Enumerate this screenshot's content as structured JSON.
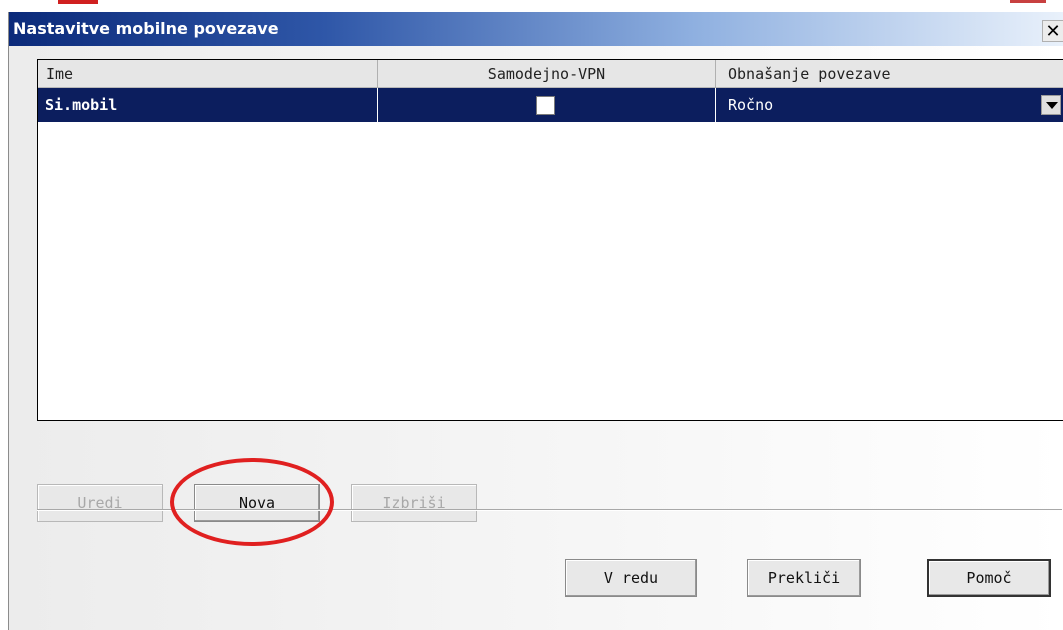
{
  "window": {
    "title": "Nastavitve mobilne povezave",
    "close_symbol": "✕"
  },
  "table": {
    "columns": [
      "Ime",
      "Samodejno-VPN",
      "Obnašanje povezave"
    ],
    "rows": [
      {
        "name": "Si.mobil",
        "auto_vpn": false,
        "behavior": "Ročno"
      }
    ]
  },
  "actions": {
    "edit": "Uredi",
    "new": "Nova",
    "delete": "Izbriši"
  },
  "footer": {
    "ok": "V redu",
    "cancel": "Prekliči",
    "help": "Pomoč"
  },
  "colors": {
    "selection": "#0c1e5e",
    "title_start": "#0b2a7a",
    "highlight": "#e02020"
  },
  "icons": [
    "close-icon",
    "chevron-down-icon"
  ]
}
